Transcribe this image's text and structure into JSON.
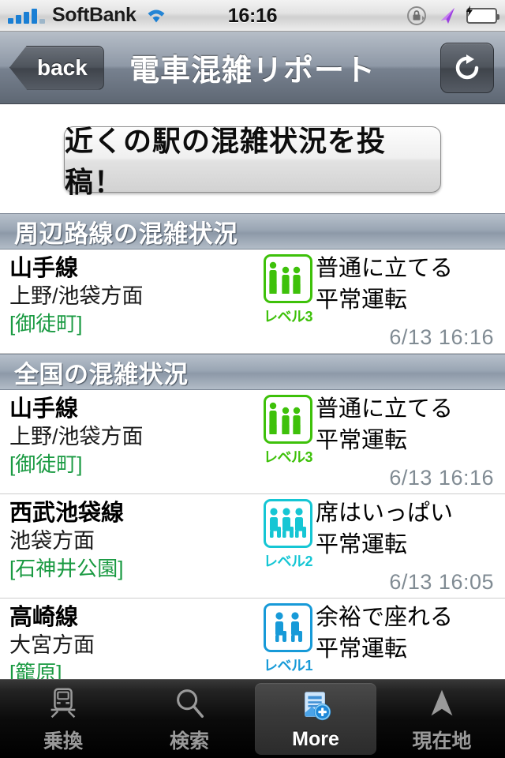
{
  "status_bar": {
    "carrier": "SoftBank",
    "time": "16:16",
    "signal_icon": "signal-bars-icon",
    "wifi_icon": "wifi-icon",
    "rotation_lock_icon": "rotation-lock-icon",
    "location_icon": "location-arrow-icon",
    "battery_icon": "battery-charging-icon"
  },
  "nav_bar": {
    "back_label": "back",
    "title": "電車混雑リポート",
    "refresh_icon": "refresh-icon"
  },
  "post_button": {
    "label": "近くの駅の混雑状況を投稿！"
  },
  "sections": [
    {
      "header": "周辺路線の混雑状況",
      "rows": [
        {
          "line": "山手線",
          "direction": "上野/池袋方面",
          "station": "[御徒町]",
          "level": 3,
          "level_label": "レベル3",
          "crowd_text": "普通に立てる",
          "service_text": "平常運転",
          "time": "6/13 16:16",
          "color": "#3ec10a",
          "posture": "standing",
          "figures": 3
        }
      ]
    },
    {
      "header": "全国の混雑状況",
      "rows": [
        {
          "line": "山手線",
          "direction": "上野/池袋方面",
          "station": "[御徒町]",
          "level": 3,
          "level_label": "レベル3",
          "crowd_text": "普通に立てる",
          "service_text": "平常運転",
          "time": "6/13 16:16",
          "color": "#3ec10a",
          "posture": "standing",
          "figures": 3
        },
        {
          "line": "西武池袋線",
          "direction": "池袋方面",
          "station": "[石神井公園]",
          "level": 2,
          "level_label": "レベル2",
          "crowd_text": "席はいっぱい",
          "service_text": "平常運転",
          "time": "6/13 16:05",
          "color": "#15c6d4",
          "posture": "seated",
          "figures": 3
        },
        {
          "line": "高崎線",
          "direction": "大宮方面",
          "station": "[籠原]",
          "level": 1,
          "level_label": "レベル1",
          "crowd_text": "余裕で座れる",
          "service_text": "平常運転",
          "time": "",
          "color": "#179ad8",
          "posture": "seated",
          "figures": 2
        }
      ]
    }
  ],
  "tab_bar": {
    "tabs": [
      {
        "label": "乗換",
        "icon": "train-icon",
        "active": false
      },
      {
        "label": "検索",
        "icon": "magnifier-icon",
        "active": false
      },
      {
        "label": "More",
        "icon": "document-plus-icon",
        "active": true
      },
      {
        "label": "現在地",
        "icon": "navigation-arrow-icon",
        "active": false
      }
    ]
  }
}
